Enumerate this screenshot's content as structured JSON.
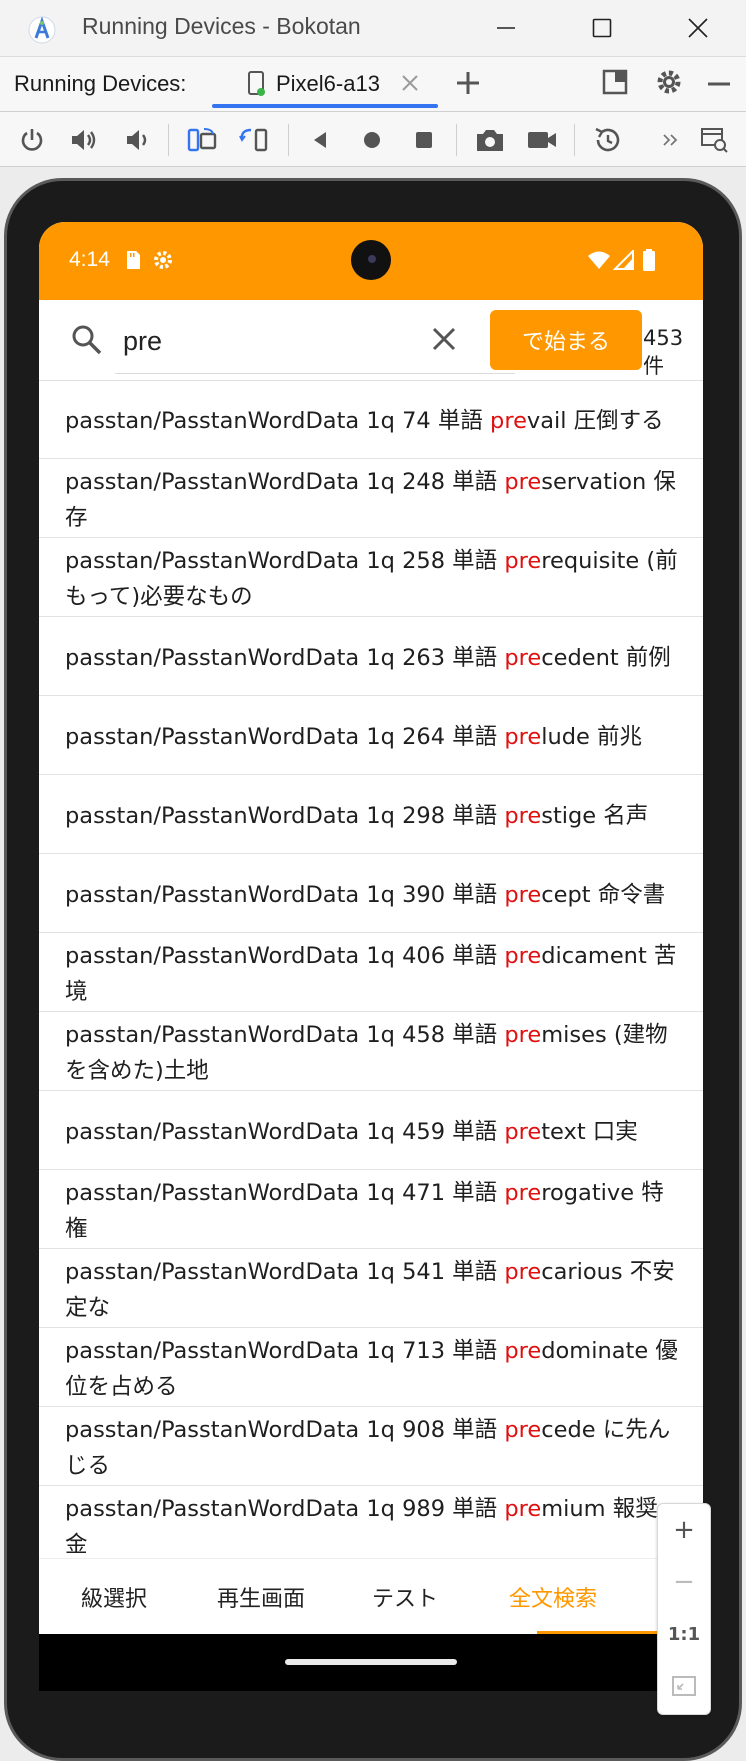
{
  "window": {
    "title": "Running Devices - Bokotan",
    "minimize_icon": "minimize-icon",
    "maximize_icon": "maximize-icon",
    "close_icon": "close-icon"
  },
  "tabbar": {
    "label": "Running Devices:",
    "device_tab": "Pixel6-a13",
    "add_icon": "plus-icon"
  },
  "toolbar": {
    "icons": [
      "power-icon",
      "volume-up-icon",
      "volume-down-icon",
      "rotate-left-icon",
      "rotate-right-icon",
      "back-icon",
      "home-icon",
      "overview-icon",
      "camera-icon",
      "video-icon",
      "snapshot-icon",
      "more-icon",
      "mirror-icon"
    ]
  },
  "statusbar": {
    "time": "4:14"
  },
  "search": {
    "value": "pre",
    "mode_button": "で始まる",
    "count": "453件"
  },
  "highlight_color": "#e01010",
  "accent_color": "#ff9800",
  "results": [
    {
      "prefix": "passtan/PasstanWordData 1q 74 単語 ",
      "match": "pre",
      "rest": "vail 圧倒する"
    },
    {
      "prefix": "passtan/PasstanWordData 1q 248 単語 ",
      "match": "pre",
      "rest": "servation 保存"
    },
    {
      "prefix": "passtan/PasstanWordData 1q 258 単語 ",
      "match": "pre",
      "rest": "requisite (前もって)必要なもの"
    },
    {
      "prefix": "passtan/PasstanWordData 1q 263 単語 ",
      "match": "pre",
      "rest": "cedent 前例"
    },
    {
      "prefix": "passtan/PasstanWordData 1q 264 単語 ",
      "match": "pre",
      "rest": "lude 前兆"
    },
    {
      "prefix": "passtan/PasstanWordData 1q 298 単語 ",
      "match": "pre",
      "rest": "stige 名声"
    },
    {
      "prefix": "passtan/PasstanWordData 1q 390 単語 ",
      "match": "pre",
      "rest": "cept 命令書"
    },
    {
      "prefix": "passtan/PasstanWordData 1q 406 単語 ",
      "match": "pre",
      "rest": "dicament 苦境"
    },
    {
      "prefix": "passtan/PasstanWordData 1q 458 単語 ",
      "match": "pre",
      "rest": "mises (建物を含めた)土地"
    },
    {
      "prefix": "passtan/PasstanWordData 1q 459 単語 ",
      "match": "pre",
      "rest": "text 口実"
    },
    {
      "prefix": "passtan/PasstanWordData 1q 471 単語 ",
      "match": "pre",
      "rest": "rogative 特権"
    },
    {
      "prefix": "passtan/PasstanWordData 1q 541 単語 ",
      "match": "pre",
      "rest": "carious 不安定な"
    },
    {
      "prefix": "passtan/PasstanWordData 1q 713 単語 ",
      "match": "pre",
      "rest": "dominate 優位を占める"
    },
    {
      "prefix": "passtan/PasstanWordData 1q 908 単語 ",
      "match": "pre",
      "rest": "cede に先んじる"
    },
    {
      "prefix": "passtan/PasstanWordData 1q 989 単語 ",
      "match": "pre",
      "rest": "mium 報奨金"
    }
  ],
  "bottom_nav": {
    "items": [
      "級選択",
      "再生画面",
      "テスト",
      "全文検索"
    ],
    "selected": 3
  },
  "zoom": {
    "plus": "+",
    "minus": "−",
    "actual": "1:1",
    "fit_icon": "fit-screen-icon"
  }
}
